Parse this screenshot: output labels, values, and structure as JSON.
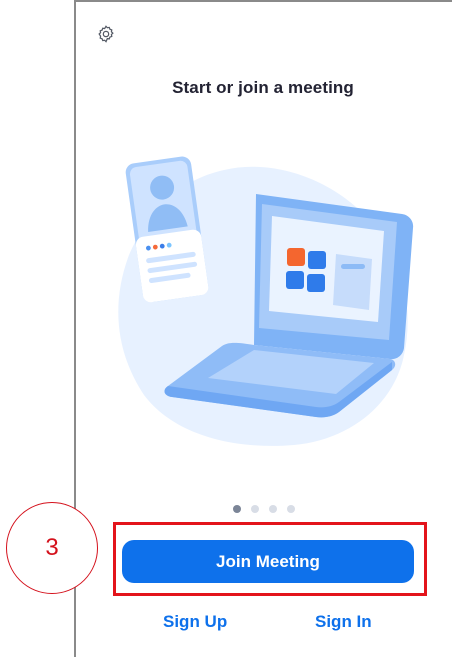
{
  "header": {
    "settings_icon": "gear-icon"
  },
  "main": {
    "title": "Start or join a meeting"
  },
  "carousel": {
    "page_count": 4,
    "active_index": 0
  },
  "actions": {
    "join_label": "Join Meeting",
    "sign_up_label": "Sign Up",
    "sign_in_label": "Sign In"
  },
  "annotation": {
    "step_number": "3"
  },
  "colors": {
    "accent": "#0e71eb",
    "annotation": "#e3141b"
  }
}
